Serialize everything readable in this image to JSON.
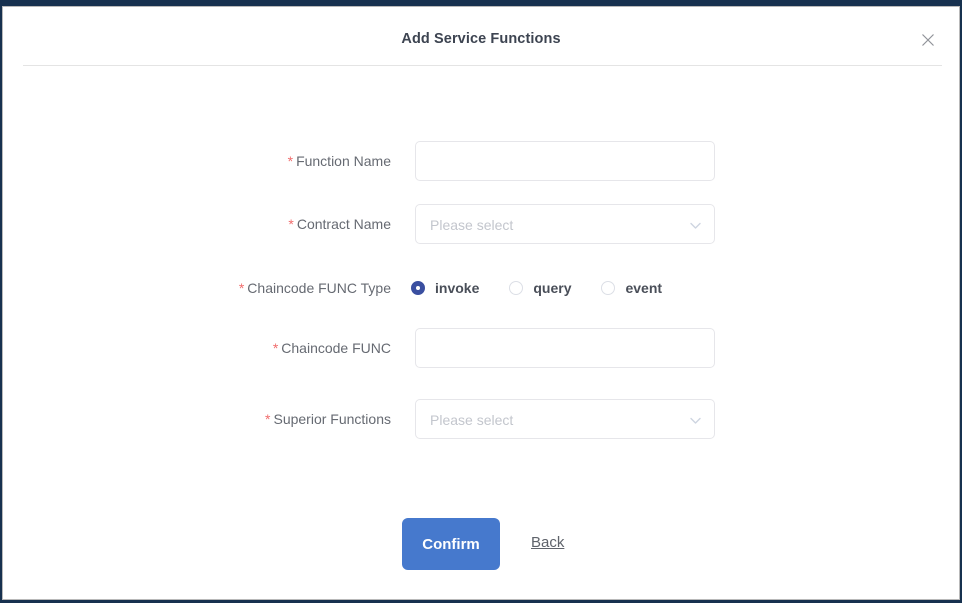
{
  "dialog": {
    "title": "Add Service Functions",
    "close_icon": "close-icon"
  },
  "form": {
    "fields": [
      {
        "label": "Function Name",
        "required": true,
        "type": "text",
        "value": "",
        "placeholder": ""
      },
      {
        "label": "Contract Name",
        "required": true,
        "type": "select",
        "value": "",
        "placeholder": "Please select"
      },
      {
        "label": "Chaincode FUNC Type",
        "required": true,
        "type": "radio",
        "selected": "invoke",
        "options": [
          {
            "label": "invoke",
            "checked": true
          },
          {
            "label": "query",
            "checked": false
          },
          {
            "label": "event",
            "checked": false
          }
        ]
      },
      {
        "label": "Chaincode FUNC",
        "required": true,
        "type": "text",
        "value": "",
        "placeholder": ""
      },
      {
        "label": "Superior Functions",
        "required": true,
        "type": "select",
        "value": "",
        "placeholder": "Please select"
      }
    ],
    "required_marker": "*"
  },
  "actions": {
    "confirm_label": "Confirm",
    "back_label": "Back"
  },
  "colors": {
    "primary_button": "#4679cd",
    "radio_checked": "#3a4fa0",
    "required_star": "#f06c6c",
    "label_text": "#666a72",
    "placeholder": "#c3c6cd",
    "border": "#e6e6ea"
  }
}
